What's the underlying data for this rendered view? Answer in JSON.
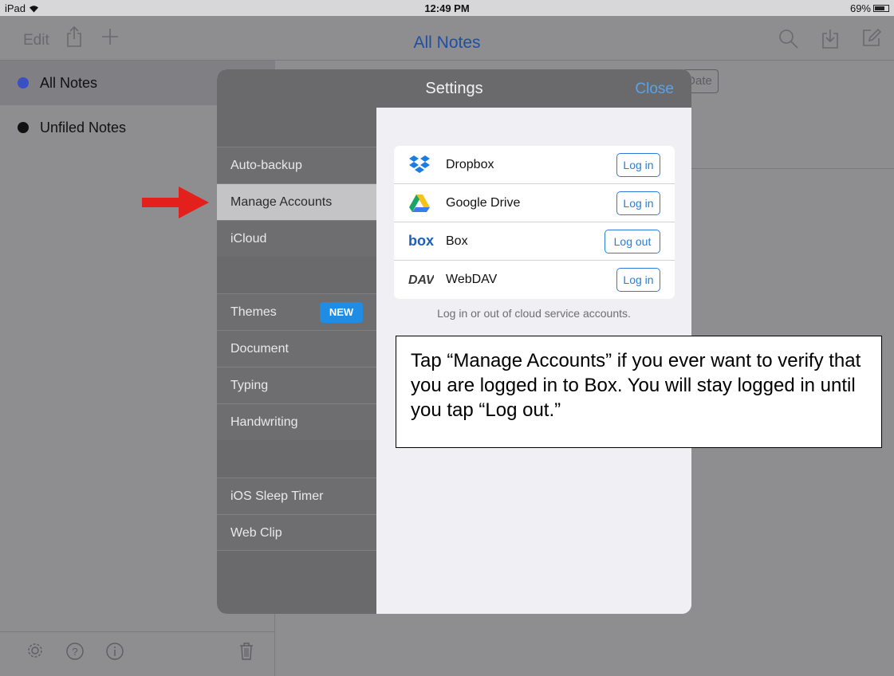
{
  "status_bar": {
    "device": "iPad",
    "time": "12:49 PM",
    "battery": "69%"
  },
  "nav": {
    "edit_label": "Edit",
    "title": "All Notes"
  },
  "sidebar": {
    "items": [
      {
        "label": "All Notes",
        "dot_color": "#3a4fc4"
      },
      {
        "label": "Unfiled Notes",
        "dot_color": "#111111"
      }
    ]
  },
  "background": {
    "sort_segment_label": "Date"
  },
  "settings": {
    "title": "Settings",
    "close_label": "Close",
    "menu": {
      "auto_backup": "Auto-backup",
      "manage_accounts": "Manage Accounts",
      "icloud": "iCloud",
      "themes": "Themes",
      "themes_badge": "NEW",
      "document": "Document",
      "typing": "Typing",
      "handwriting": "Handwriting",
      "ios_sleep_timer": "iOS Sleep Timer",
      "web_clip": "Web Clip"
    },
    "selected_menu": "Manage Accounts",
    "accounts": [
      {
        "name": "Dropbox",
        "action": "Log in",
        "icon": "dropbox-icon"
      },
      {
        "name": "Google Drive",
        "action": "Log in",
        "icon": "google-drive-icon"
      },
      {
        "name": "Box",
        "action": "Log out",
        "icon": "box-icon"
      },
      {
        "name": "WebDAV",
        "action": "Log in",
        "icon": "webdav-icon"
      }
    ],
    "accounts_footer": "Log in or out of cloud service accounts."
  },
  "annotation": {
    "callout_text": "Tap “Manage Accounts” if you ever want to verify that you are logged in to Box. You will stay logged in until you tap “Log out.”",
    "arrow_color": "#e3201b"
  }
}
